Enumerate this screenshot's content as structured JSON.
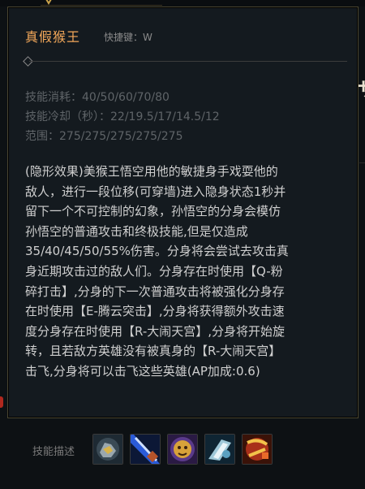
{
  "tooltip": {
    "title": "真假猴王",
    "hotkey": "快捷键：W",
    "cost": "技能消耗：40/50/60/70/80",
    "cooldown": "技能冷却（秒）：22/19.5/17/14.5/12",
    "range": "范围：275/275/275/275/275",
    "description_lines": [
      "(隐形效果)美猴王悟空用他的敏捷身手戏耍他的",
      "敌人，进行一段位移(可穿墙)进入隐身状态1秒并",
      "留下一个不可控制的幻象，孙悟空的分身会模仿",
      "孙悟空的普通攻击和终极技能,但是仅造成",
      "35/40/45/50/55%伤害。分身将会尝试去攻击真",
      "身近期攻击过的敌人们。分身存在时使用【Q-粉",
      "碎打击】,分身的下一次普通攻击将被强化分身存",
      "在时使用【E-腾云突击】,分身将获得额外攻击速",
      "度分身存在时使用【R-大闹天宫】,分身将开始旋",
      "转，且若敌方英雄没有被真身的【R-大闹天宫】",
      "击飞,分身将可以击飞这些英雄(AP加成:0.6)"
    ]
  },
  "skills_section": {
    "label": "技能描述",
    "icons": [
      "stone-fist-icon",
      "blue-staff-icon",
      "golden-monkey-face-icon",
      "silver-cloud-icon",
      "red-gold-staff-icon"
    ]
  },
  "colors": {
    "title": "#f3a85a",
    "stat_text": "#5f6468",
    "description_text": "#cfcfcf",
    "border": "#4a4630"
  }
}
